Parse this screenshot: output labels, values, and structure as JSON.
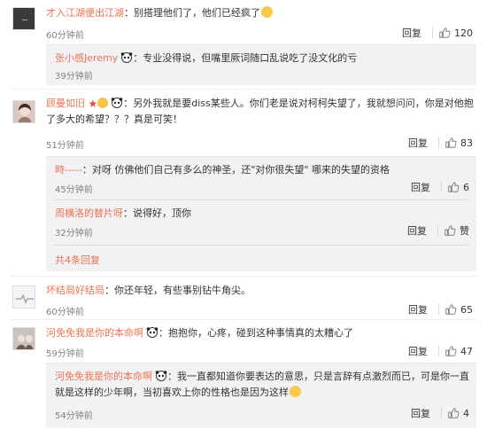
{
  "comments": [
    {
      "user": "才入江湖便出江湖",
      "text": "别搭理他们了，他们已经疯了",
      "time": "60分钟前",
      "reply_label": "回复",
      "likes": "120",
      "replies": [
        {
          "user": "张小感Jeremy",
          "text": "专业没得说，但嘴里厥词随口乱说吃了没文化的亏",
          "time": "39分钟前"
        }
      ]
    },
    {
      "user": "顾曼如旧",
      "text": "另外我就是要diss某些人。你们老是说对柯柯失望了，我就想问问，你是对他抱了多大的希望？？？真是可笑！",
      "time": "51分钟前",
      "reply_label": "回复",
      "likes": "83",
      "replies": [
        {
          "user": "時-----",
          "text": "对呀 仿佛他们自己有多么的神圣，还\"对你很失望\" 哪来的失望的资格",
          "time": "45分钟前",
          "reply_label": "回复",
          "likes": "6"
        },
        {
          "user": "周横洛的替片呀",
          "text": "说得好，顶你",
          "time": "32分钟前",
          "reply_label": "回复",
          "likes": "赞"
        }
      ],
      "more_replies": "共4条回复"
    },
    {
      "user": "坏结局好结局",
      "text": "你还年轻，有些事别钻牛角尖。",
      "time": "60分钟前",
      "reply_label": "回复",
      "likes": "65"
    },
    {
      "user": "河免免我是你的本命啊",
      "text": "抱抱你，心疼，碰到这种事情真的太糟心了",
      "time": "59分钟前",
      "reply_label": "回复",
      "likes": "47",
      "replies": [
        {
          "user": "河免免我是你的本命啊",
          "text": "我一直都知道你要表达的意思，只是言辞有点激烈而已，可是你一直就是这样的少年啊，当初喜欢上你的性格也是因为这样",
          "time": "54分钟前",
          "reply_label": "回复",
          "likes": "4"
        }
      ]
    }
  ],
  "colors": {
    "username": "#eb7350",
    "reply_bg": "#f2f2f5",
    "time": "#808080"
  }
}
